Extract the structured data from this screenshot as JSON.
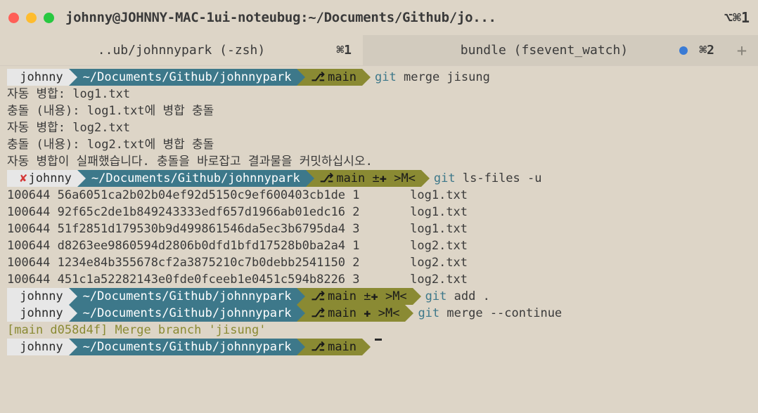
{
  "window": {
    "title": "johnny@JOHNNY-MAC-1ui-noteubug:~/Documents/Github/jo...",
    "topright": "⌥⌘1"
  },
  "tabs": [
    {
      "label": "..ub/johnnypark (-zsh)",
      "shortcut": "⌘1"
    },
    {
      "label": "bundle (fsevent_watch)",
      "shortcut": "⌘2"
    }
  ],
  "prompts": {
    "user": "johnny",
    "err_user": "✘ johnny",
    "path": "~/Documents/Github/johnnypark",
    "branch_main": "main",
    "branch_conflict": "main ±✚ >M<",
    "branch_added": "main ✚ >M<",
    "branch_icon": "⎇"
  },
  "cmds": {
    "merge": "merge jisung",
    "lsfiles": "ls-files -u",
    "add": "add .",
    "continue": "merge --continue",
    "git": "git"
  },
  "output": {
    "k1": "자동 병합: log1.txt",
    "k2": "충돌 (내용): log1.txt에 병합 충돌",
    "k3": "자동 병합: log2.txt",
    "k4": "충돌 (내용): log2.txt에 병합 충돌",
    "k5": "자동 병합이 실패했습니다. 충돌을 바로잡고 결과물을 커밋하십시오.",
    "ls": [
      "100644 56a6051ca2b02b04ef92d5150c9ef600403cb1de 1       log1.txt",
      "100644 92f65c2de1b849243333edf657d1966ab01edc16 2       log1.txt",
      "100644 51f2851d179530b9d499861546da5ec3b6795da4 3       log1.txt",
      "100644 d8263ee9860594d2806b0dfd1bfd17528b0ba2a4 1       log2.txt",
      "100644 1234e84b355678cf2a3875210c7b0debb2541150 2       log2.txt",
      "100644 451c1a52282143e0fde0fceeb1e0451c594b8226 3       log2.txt"
    ],
    "commit": "[main d058d4f] Merge branch 'jisung'"
  }
}
